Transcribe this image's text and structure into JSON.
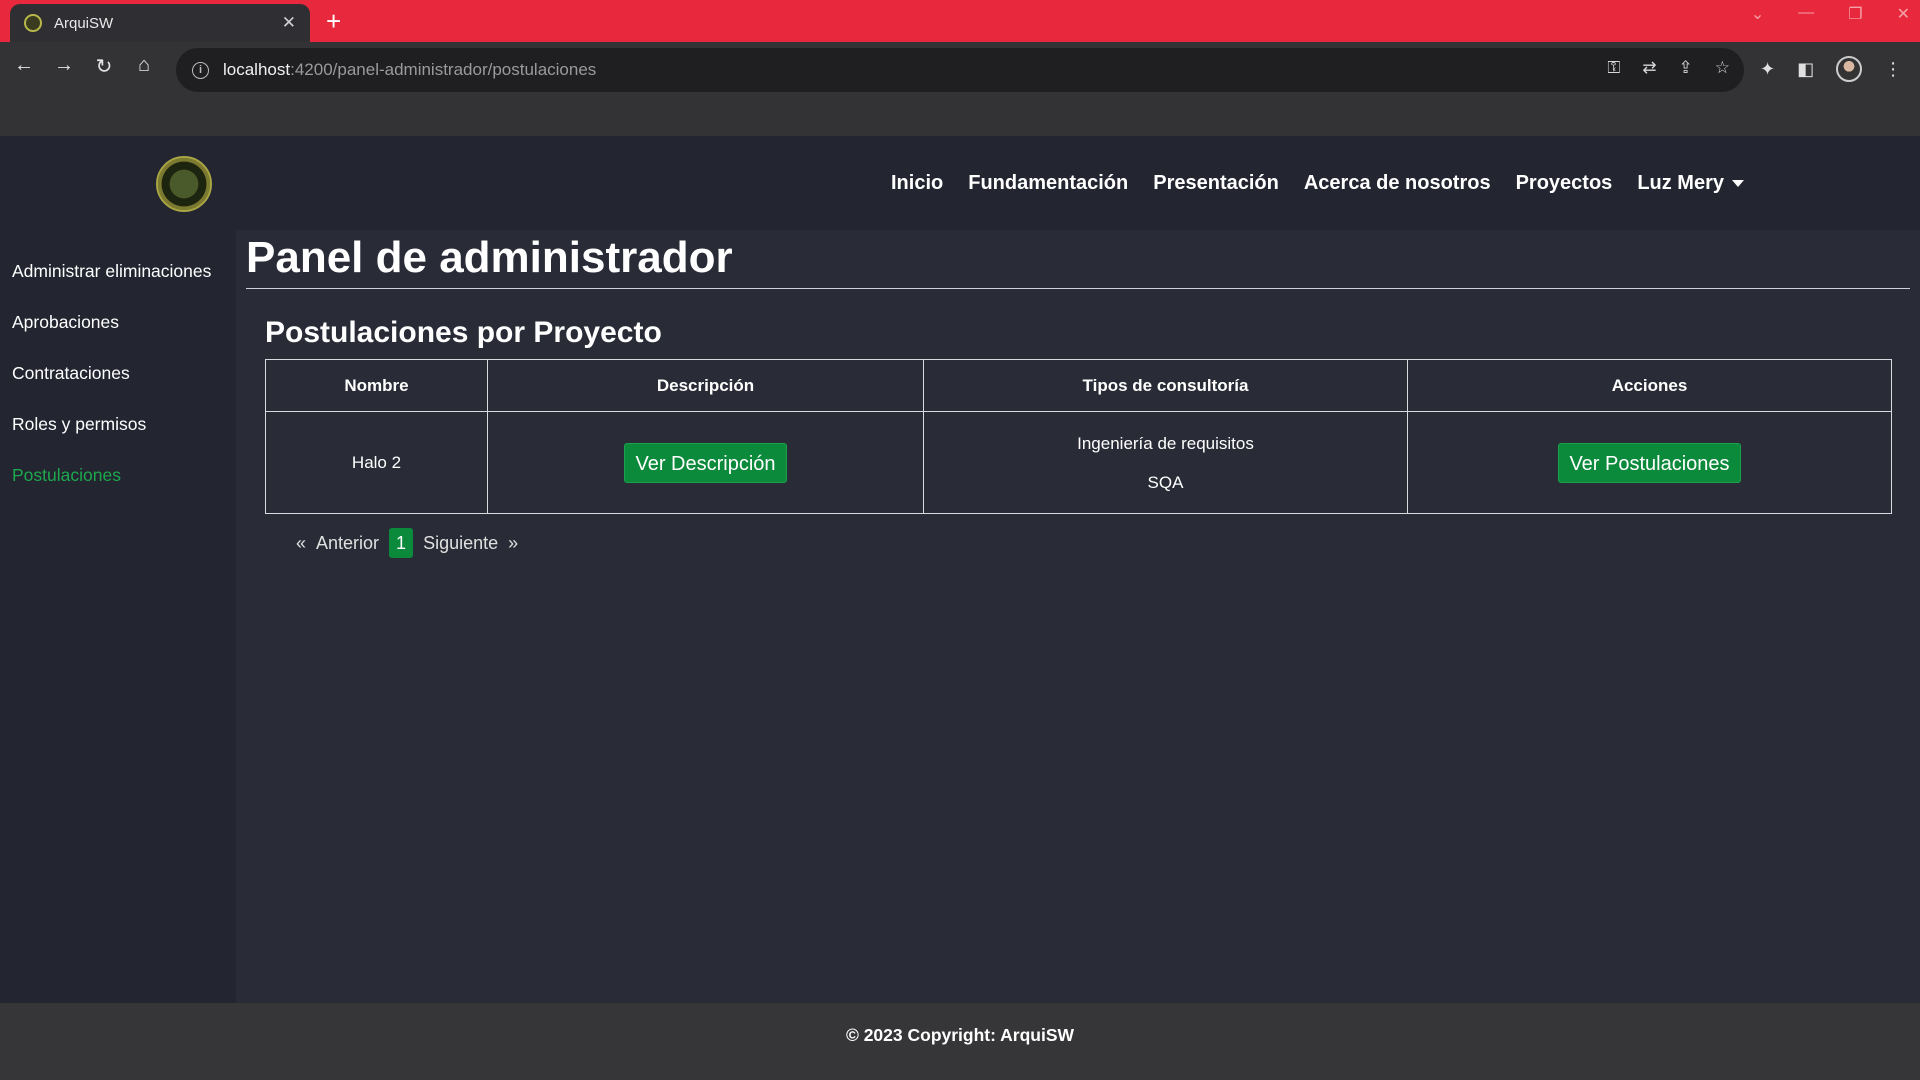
{
  "browser": {
    "tab_title": "ArquiSW",
    "url_host": "localhost",
    "url_path": ":4200/panel-administrador/postulaciones"
  },
  "navbar": {
    "items": [
      "Inicio",
      "Fundamentación",
      "Presentación",
      "Acerca de nosotros",
      "Proyectos"
    ],
    "user": "Luz Mery"
  },
  "sidebar": {
    "items": [
      {
        "label": "Administrar eliminaciones"
      },
      {
        "label": "Aprobaciones"
      },
      {
        "label": "Contrataciones"
      },
      {
        "label": "Roles y permisos"
      },
      {
        "label": "Postulaciones",
        "active": true
      }
    ]
  },
  "main": {
    "page_title": "Panel de administrador",
    "section_title": "Postulaciones por Proyecto",
    "table": {
      "headers": [
        "Nombre",
        "Descripción",
        "Tipos de consultoría",
        "Acciones"
      ],
      "rows": [
        {
          "nombre": "Halo 2",
          "descripcion_button": "Ver Descripción",
          "tipos": [
            "Ingeniería de requisitos",
            "SQA"
          ],
          "acciones_button": "Ver Postulaciones"
        }
      ]
    },
    "pagination": {
      "prev_symbol": "«",
      "prev_label": "Anterior",
      "current_page": "1",
      "next_label": "Siguiente",
      "next_symbol": "»"
    }
  },
  "footer": {
    "text": "© 2023 Copyright: ArquiSW"
  },
  "colors": {
    "accent_green": "#0c8a3c",
    "active_link": "#1ea84e",
    "tabbar_red": "#e8293d"
  }
}
